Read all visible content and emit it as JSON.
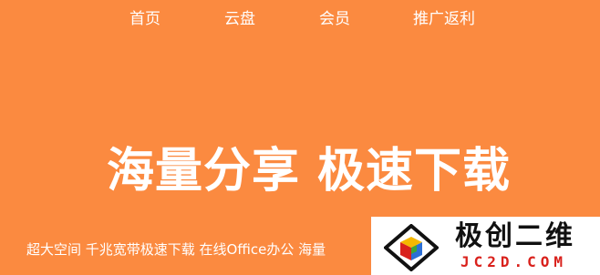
{
  "nav": {
    "items": [
      {
        "label": "首页"
      },
      {
        "label": "云盘"
      },
      {
        "label": "会员"
      },
      {
        "label": "推广返利"
      }
    ]
  },
  "hero": {
    "headline": "海量分享 极速下载",
    "tagline": "超大空间 千兆宽带极速下载 在线Office办公 海量"
  },
  "watermark": {
    "title": "极创二维",
    "domain": "JC2D.COM"
  },
  "colors": {
    "background": "#fb8a40",
    "text": "#ffffff",
    "watermark_bg": "#ffffff",
    "watermark_domain": "#d9211c"
  }
}
